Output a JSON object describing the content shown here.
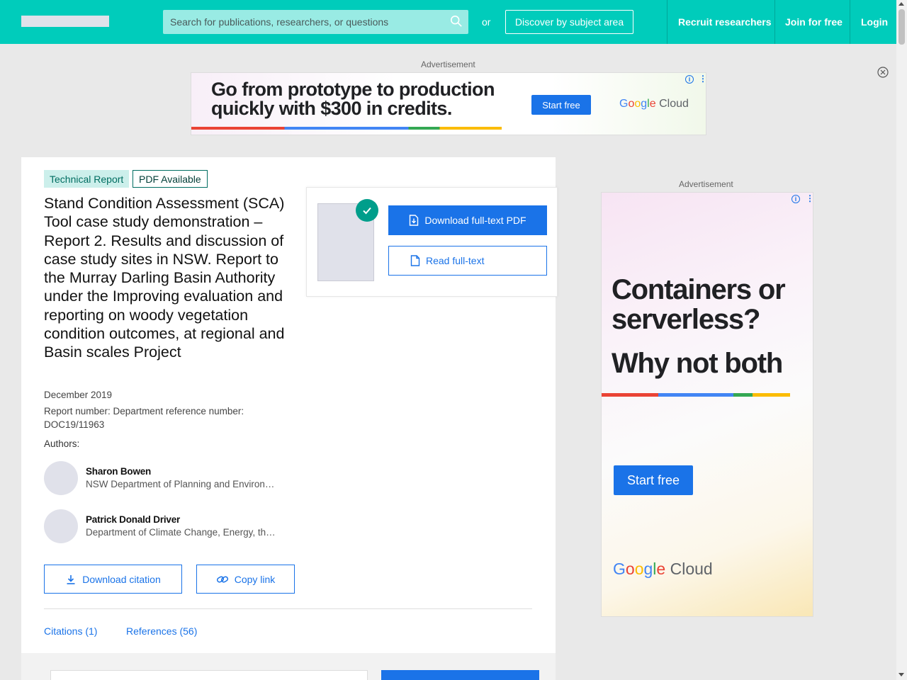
{
  "header": {
    "search_placeholder": "Search for publications, researchers, or questions",
    "or_text": "or",
    "discover_label": "Discover by subject area",
    "nav": [
      "Recruit researchers",
      "Join for free",
      "Login"
    ]
  },
  "ads": {
    "label": "Advertisement",
    "top": {
      "headline": "Go from prototype to production quickly with $300 in credits.",
      "cta": "Start free",
      "brand": "Google Cloud"
    },
    "side": {
      "headline1": "Containers or serverless?",
      "headline2": "Why not both",
      "cta": "Start free",
      "brand": "Google Cloud"
    }
  },
  "publication": {
    "type_badge": "Technical Report",
    "pdf_badge": "PDF Available",
    "title": "Stand Condition Assessment (SCA) Tool case study demonstration – Report 2. Results and discussion of case study sites in NSW. Report to the Murray Darling Basin Authority under the Improving evaluation and reporting on woody vegetation condition outcomes, at regional and Basin scales Project",
    "date": "December 2019",
    "report_number": "Report number: Department reference number: DOC19/11963",
    "authors_label": "Authors:",
    "authors": [
      {
        "name": "Sharon Bowen",
        "affiliation": "NSW Department of Planning and Environment"
      },
      {
        "name": "Patrick Donald Driver",
        "affiliation": "Department of Climate Change, Energy, the Environment and Water"
      }
    ],
    "download_citation": "Download citation",
    "copy_link": "Copy link",
    "tabs": [
      "Citations (1)",
      "References (56)"
    ]
  },
  "pdf_panel": {
    "download_label": "Download full-text PDF",
    "read_label": "Read full-text"
  },
  "colors": {
    "brand": "#00ccbb",
    "primary": "#1a73e8"
  }
}
